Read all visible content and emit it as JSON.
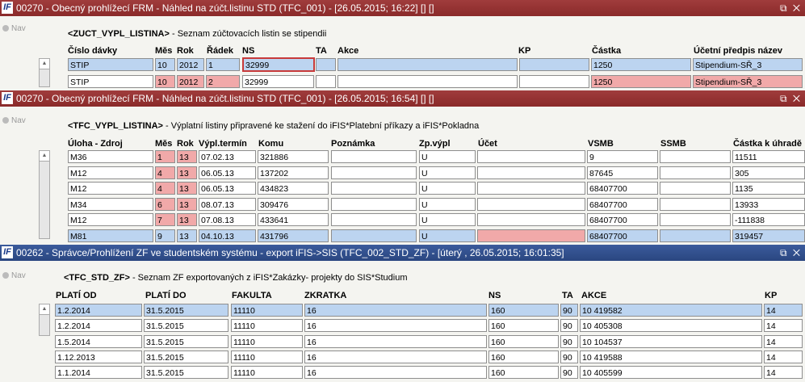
{
  "windows": [
    {
      "title": "00270 - Obecný prohlížecí FRM - Náhled na zúčt.listinu STD (TFC_001) - [26.05.2015; 16:22] [] []",
      "controls": "⧉ ✕",
      "nav": "Nav",
      "block_code": "<ZUCT_VYPL_LISTINA>",
      "block_desc": " - Seznam zúčtovacích listin se stipendii",
      "headers": [
        "Číslo dávky",
        "Měs",
        "Rok",
        "Řádek",
        "NS",
        "TA",
        "Akce",
        "KP",
        "Částka",
        "Účetní předpis název"
      ],
      "rows": [
        [
          "STIP",
          "10",
          "2012",
          "1",
          "32999",
          "",
          "",
          "",
          "1250",
          "Stipendium-SŘ_3"
        ],
        [
          "STIP",
          "10",
          "2012",
          "2",
          "32999",
          "",
          "",
          "",
          "1250",
          "Stipendium-SŘ_3"
        ]
      ]
    },
    {
      "title": "00270 - Obecný prohlížecí FRM - Náhled na zúčt.listinu STD (TFC_001) - [26.05.2015; 16:54] [] []",
      "controls": "⧉ ✕",
      "nav": "Nav",
      "block_code": "<TFC_VYPL_LISTINA>",
      "block_desc": " - Výplatní listiny připravené ke stažení do iFIS*Platební příkazy a iFIS*Pokladna",
      "headers": [
        "Úloha - Zdroj",
        "Měs",
        "Rok",
        "Výpl.termín",
        "Komu",
        "Poznámka",
        "Zp.výpl",
        "Účet",
        "VSMB",
        "SSMB",
        "Částka k úhradě"
      ],
      "rows": [
        [
          "M36",
          "1",
          "13",
          "07.02.13",
          "321886",
          "",
          "U",
          "",
          "9",
          "",
          "11511"
        ],
        [
          "M12",
          "4",
          "13",
          "06.05.13",
          "137202",
          "",
          "U",
          "",
          "87645",
          "",
          "305"
        ],
        [
          "M12",
          "4",
          "13",
          "06.05.13",
          "434823",
          "",
          "U",
          "",
          "68407700",
          "",
          "1135"
        ],
        [
          "M34",
          "6",
          "13",
          "08.07.13",
          "309476",
          "",
          "U",
          "",
          "68407700",
          "",
          "13933"
        ],
        [
          "M12",
          "7",
          "13",
          "07.08.13",
          "433641",
          "",
          "U",
          "",
          "68407700",
          "",
          "-111838"
        ],
        [
          "M81",
          "9",
          "13",
          "04.10.13",
          "431796",
          "",
          "U",
          "",
          "68407700",
          "",
          "319457"
        ]
      ]
    },
    {
      "title": "00262 - Správce/Prohlížení ZF ve studentském systému - export iFIS->SIS (TFC_002_STD_ZF) - [úterý  , 26.05.2015; 16:01:35]",
      "controls": "⧉ ✕",
      "nav": "Nav",
      "block_code": "<TFC_STD_ZF>",
      "block_desc": " - Seznam ZF exportovaných z iFIS*Zakázky- projekty do SIS*Studium",
      "headers": [
        "PLATÍ OD",
        "PLATÍ DO",
        "FAKULTA",
        "ZKRATKA",
        "NS",
        "TA",
        "AKCE",
        "KP"
      ],
      "rows": [
        [
          "1.2.2014",
          "31.5.2015",
          "11110",
          "16",
          "160",
          "90",
          "10 419582",
          "14"
        ],
        [
          "1.2.2014",
          "31.5.2015",
          "11110",
          "16",
          "160",
          "90",
          "10 405308",
          "14"
        ],
        [
          "1.5.2014",
          "31.5.2015",
          "11110",
          "16",
          "160",
          "90",
          "10 104537",
          "14"
        ],
        [
          "1.12.2013",
          "31.5.2015",
          "11110",
          "16",
          "160",
          "90",
          "10 419588",
          "14"
        ],
        [
          "1.1.2014",
          "31.5.2015",
          "11110",
          "16",
          "160",
          "90",
          "10 405599",
          "14"
        ]
      ]
    }
  ]
}
